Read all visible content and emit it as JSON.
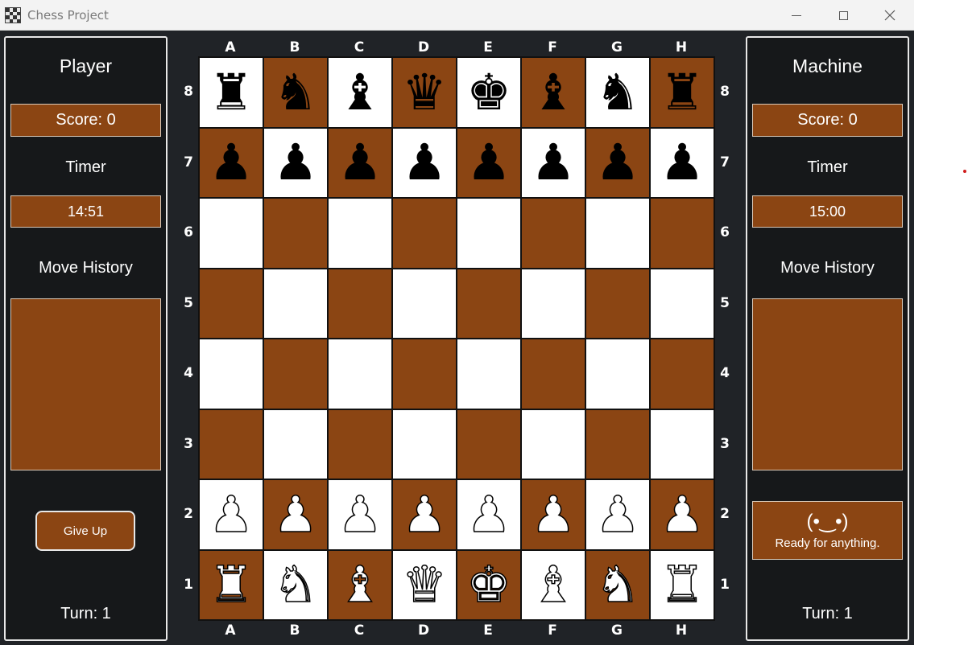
{
  "window": {
    "title": "Chess Project",
    "icon": "chessboard-icon",
    "controls": [
      "minimize-icon",
      "maximize-icon",
      "close-icon"
    ]
  },
  "player": {
    "name": "Player",
    "score": "Score: 0",
    "timer_label": "Timer",
    "timer": "14:51",
    "history_label": "Move History",
    "give_up": "Give Up",
    "turn": "Turn: 1"
  },
  "machine": {
    "name": "Machine",
    "score": "Score: 0",
    "timer_label": "Timer",
    "timer": "15:00",
    "history_label": "Move History",
    "status_face": "(•‿•)",
    "status_message": "Ready for anything.",
    "turn": "Turn: 1"
  },
  "board": {
    "files": [
      "A",
      "B",
      "C",
      "D",
      "E",
      "F",
      "G",
      "H"
    ],
    "ranks": [
      "8",
      "7",
      "6",
      "5",
      "4",
      "3",
      "2",
      "1"
    ],
    "light_color": "#ffffff",
    "dark_color": "#8b4513",
    "rows": [
      [
        "r",
        "n",
        "b",
        "q",
        "k",
        "b",
        "n",
        "r"
      ],
      [
        "p",
        "p",
        "p",
        "p",
        "p",
        "p",
        "p",
        "p"
      ],
      [
        "",
        "",
        "",
        "",
        "",
        "",
        "",
        ""
      ],
      [
        "",
        "",
        "",
        "",
        "",
        "",
        "",
        ""
      ],
      [
        "",
        "",
        "",
        "",
        "",
        "",
        "",
        ""
      ],
      [
        "",
        "",
        "",
        "",
        "",
        "",
        "",
        ""
      ],
      [
        "P",
        "P",
        "P",
        "P",
        "P",
        "P",
        "P",
        "P"
      ],
      [
        "R",
        "N",
        "B",
        "Q",
        "K",
        "B",
        "N",
        "R"
      ]
    ]
  },
  "colors": {
    "background": "#202327",
    "panel": "#16181a",
    "accent": "#8b4513"
  }
}
